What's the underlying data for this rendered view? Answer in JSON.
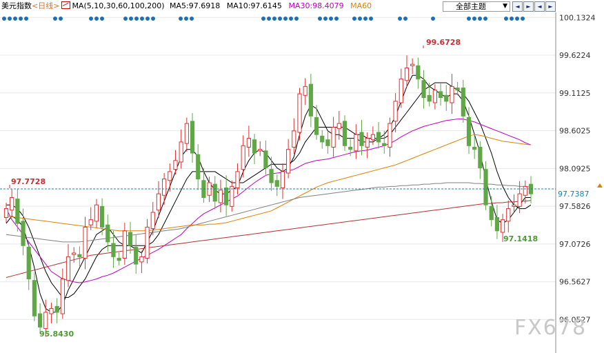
{
  "header": {
    "title": "美元指数",
    "period": "<日线>",
    "ma_label": "MA(5,10,30,60,100,200)",
    "ma5": "MA5:97.6918",
    "ma10": "MA10:97.6145",
    "ma30": "MA30:98.4079",
    "ma60": "MA60",
    "theme_label": "全部主题",
    "colors": {
      "ma5": "#000000",
      "ma10": "#000000",
      "ma30": "#c000c0",
      "ma60": "#e08000",
      "period": "#e07020"
    }
  },
  "nav_buttons": [
    "◄",
    "►",
    "◄",
    "►"
  ],
  "watermark": "FX678",
  "chart_data": {
    "type": "candlestick",
    "ylim": [
      95.6,
      100.2
    ],
    "yticks": [
      "100.1324",
      "99.6224",
      "99.1125",
      "98.6025",
      "98.0925",
      "97.5826",
      "97.0726",
      "96.5627",
      "96.0527"
    ],
    "annotations": {
      "high": "99.6728",
      "low_left": "95.8430",
      "low_right": "97.1418",
      "level_left": "97.7728",
      "current": "97.7387"
    },
    "up_color": "#e03030",
    "down_color": "#60a845",
    "closes": [
      97.55,
      97.7,
      97.35,
      97.05,
      96.6,
      96.1,
      95.95,
      96.15,
      96.2,
      96.15,
      96.6,
      96.9,
      96.95,
      96.9,
      97.3,
      97.4,
      97.6,
      97.3,
      97.1,
      96.9,
      96.85,
      97.25,
      97.05,
      96.8,
      96.9,
      97.3,
      97.5,
      97.75,
      97.95,
      98.05,
      98.2,
      98.45,
      98.7,
      98.3,
      97.95,
      97.7,
      97.9,
      97.65,
      97.8,
      97.6,
      97.85,
      98.05,
      98.4,
      98.5,
      98.3,
      98.35,
      98.1,
      97.9,
      97.85,
      98.05,
      98.35,
      98.6,
      99.1,
      99.2,
      98.8,
      98.55,
      98.45,
      98.4,
      98.65,
      98.7,
      98.4,
      98.35,
      98.55,
      98.4,
      98.5,
      98.55,
      98.45,
      98.4,
      98.7,
      99.0,
      99.3,
      99.45,
      99.5,
      99.3,
      99.05,
      99.0,
      99.15,
      99.05,
      99.0,
      99.2,
      99.15,
      98.8,
      98.4,
      98.35,
      98.1,
      97.6,
      97.4,
      97.25,
      97.4,
      97.55,
      97.6,
      97.75,
      97.85,
      97.75
    ],
    "ma_lines": [
      {
        "name": "MA5",
        "color": "#000000",
        "values": [
          97.35,
          97.45,
          97.4,
          97.3,
          97.05,
          96.75,
          96.4,
          96.2,
          96.15,
          96.15,
          96.25,
          96.45,
          96.6,
          96.75,
          96.9,
          97.05,
          97.2,
          97.25,
          97.3,
          97.2,
          97.1,
          97.05,
          97.05,
          97.0,
          96.95,
          97.1,
          97.25,
          97.45,
          97.65,
          97.85,
          98.05,
          98.25,
          98.35,
          98.35,
          98.25,
          98.05,
          97.9,
          97.8,
          97.75,
          97.75,
          97.8,
          97.85,
          98.05,
          98.2,
          98.3,
          98.35,
          98.3,
          98.2,
          98.1,
          98.05,
          98.1,
          98.25,
          98.55,
          98.8,
          98.95,
          98.9,
          98.75,
          98.6,
          98.55,
          98.55,
          98.5,
          98.5,
          98.5,
          98.45,
          98.45,
          98.45,
          98.5,
          98.55,
          98.65,
          98.8,
          99.0,
          99.2,
          99.35,
          99.35,
          99.3,
          99.2,
          99.15,
          99.1,
          99.05,
          99.1,
          99.1,
          99.0,
          98.8,
          98.55,
          98.3,
          97.95,
          97.65,
          97.4,
          97.35,
          97.4,
          97.5,
          97.6,
          97.7,
          97.7
        ]
      },
      {
        "name": "MA10",
        "color": "#000000",
        "values": [
          97.6,
          97.6,
          97.55,
          97.45,
          97.3,
          97.1,
          96.9,
          96.7,
          96.55,
          96.45,
          96.35,
          96.35,
          96.4,
          96.5,
          96.6,
          96.75,
          96.9,
          97.0,
          97.05,
          97.05,
          97.05,
          97.05,
          97.05,
          97.05,
          97.05,
          97.05,
          97.1,
          97.2,
          97.35,
          97.5,
          97.65,
          97.8,
          97.95,
          98.05,
          98.05,
          98.05,
          98.05,
          98.05,
          98.0,
          97.95,
          97.9,
          97.9,
          97.9,
          97.95,
          98.0,
          98.05,
          98.1,
          98.15,
          98.15,
          98.15,
          98.15,
          98.2,
          98.3,
          98.45,
          98.55,
          98.65,
          98.65,
          98.65,
          98.65,
          98.65,
          98.65,
          98.6,
          98.55,
          98.55,
          98.5,
          98.5,
          98.5,
          98.5,
          98.55,
          98.65,
          98.75,
          98.85,
          98.95,
          99.05,
          99.15,
          99.2,
          99.25,
          99.25,
          99.25,
          99.2,
          99.15,
          99.1,
          99.0,
          98.85,
          98.7,
          98.5,
          98.3,
          98.05,
          97.85,
          97.7,
          97.6,
          97.55,
          97.55,
          97.6
        ]
      },
      {
        "name": "MA30",
        "color": "#c000c0",
        "values": [
          97.55,
          97.4,
          97.3,
          97.2,
          97.1,
          97.0,
          96.9,
          96.8,
          96.7,
          96.65,
          96.6,
          96.58,
          96.56,
          96.55,
          96.56,
          96.58,
          96.6,
          96.63,
          96.65,
          96.68,
          96.72,
          96.76,
          96.8,
          96.84,
          96.88,
          96.92,
          96.96,
          97.0,
          97.05,
          97.1,
          97.15,
          97.2,
          97.28,
          97.35,
          97.42,
          97.48,
          97.52,
          97.56,
          97.6,
          97.64,
          97.68,
          97.72,
          97.78,
          97.84,
          97.9,
          97.95,
          98.0,
          98.02,
          98.03,
          98.04,
          98.06,
          98.08,
          98.12,
          98.16,
          98.18,
          98.2,
          98.21,
          98.22,
          98.24,
          98.26,
          98.28,
          98.3,
          98.32,
          98.33,
          98.34,
          98.36,
          98.38,
          98.4,
          98.43,
          98.47,
          98.52,
          98.56,
          98.6,
          98.63,
          98.66,
          98.68,
          98.7,
          98.72,
          98.74,
          98.75,
          98.76,
          98.76,
          98.74,
          98.72,
          98.69,
          98.66,
          98.63,
          98.6,
          98.57,
          98.54,
          98.51,
          98.48,
          98.44,
          98.41
        ]
      },
      {
        "name": "MA60",
        "color": "#e08000",
        "values": [
          97.45,
          97.44,
          97.43,
          97.42,
          97.41,
          97.4,
          97.39,
          97.38,
          97.37,
          97.36,
          97.35,
          97.34,
          97.33,
          97.32,
          97.31,
          97.3,
          97.29,
          97.28,
          97.27,
          97.26,
          97.25,
          97.25,
          97.25,
          97.25,
          97.25,
          97.25,
          97.26,
          97.27,
          97.28,
          97.29,
          97.3,
          97.31,
          97.32,
          97.33,
          97.33,
          97.33,
          97.34,
          97.34,
          97.35,
          97.36,
          97.38,
          97.4,
          97.42,
          97.44,
          97.46,
          97.48,
          97.5,
          97.52,
          97.56,
          97.6,
          97.64,
          97.68,
          97.72,
          97.76,
          97.8,
          97.84,
          97.87,
          97.9,
          97.92,
          97.94,
          97.96,
          97.98,
          98.0,
          98.02,
          98.04,
          98.06,
          98.08,
          98.1,
          98.12,
          98.14,
          98.17,
          98.2,
          98.23,
          98.26,
          98.29,
          98.32,
          98.35,
          98.38,
          98.41,
          98.44,
          98.47,
          98.5,
          98.53,
          98.55,
          98.54,
          98.52,
          98.5,
          98.48,
          98.46,
          98.45,
          98.44,
          98.43,
          98.42,
          98.41
        ]
      },
      {
        "name": "MA100",
        "color": "#808080",
        "values": [
          97.2,
          97.19,
          97.18,
          97.17,
          97.16,
          97.15,
          97.14,
          97.13,
          97.12,
          97.11,
          97.1,
          97.1,
          97.1,
          97.1,
          97.11,
          97.12,
          97.13,
          97.14,
          97.15,
          97.16,
          97.17,
          97.18,
          97.19,
          97.2,
          97.21,
          97.22,
          97.23,
          97.24,
          97.25,
          97.26,
          97.27,
          97.28,
          97.3,
          97.32,
          97.34,
          97.36,
          97.38,
          97.4,
          97.42,
          97.44,
          97.46,
          97.48,
          97.5,
          97.52,
          97.54,
          97.56,
          97.58,
          97.6,
          97.62,
          97.64,
          97.66,
          97.68,
          97.7,
          97.71,
          97.72,
          97.73,
          97.74,
          97.75,
          97.76,
          97.77,
          97.78,
          97.79,
          97.8,
          97.81,
          97.82,
          97.83,
          97.84,
          97.84,
          97.85,
          97.85,
          97.86,
          97.86,
          97.87,
          97.87,
          97.88,
          97.88,
          97.89,
          97.89,
          97.9,
          97.9,
          97.9,
          97.9,
          97.9,
          97.89,
          97.89,
          97.88,
          97.88,
          97.87,
          97.87,
          97.86,
          97.86,
          97.85,
          97.85,
          97.84
        ]
      },
      {
        "name": "MA200",
        "color": "#b03030",
        "values": [
          96.62,
          96.64,
          96.66,
          96.68,
          96.7,
          96.72,
          96.74,
          96.76,
          96.78,
          96.8,
          96.82,
          96.84,
          96.86,
          96.88,
          96.9,
          96.92,
          96.93,
          96.94,
          96.95,
          96.96,
          96.97,
          96.98,
          96.99,
          97.0,
          97.01,
          97.02,
          97.03,
          97.04,
          97.05,
          97.06,
          97.07,
          97.08,
          97.09,
          97.1,
          97.11,
          97.12,
          97.13,
          97.14,
          97.15,
          97.16,
          97.17,
          97.18,
          97.19,
          97.2,
          97.21,
          97.22,
          97.23,
          97.24,
          97.25,
          97.26,
          97.27,
          97.28,
          97.29,
          97.3,
          97.31,
          97.32,
          97.33,
          97.34,
          97.35,
          97.36,
          97.37,
          97.38,
          97.39,
          97.4,
          97.41,
          97.42,
          97.43,
          97.44,
          97.45,
          97.46,
          97.47,
          97.48,
          97.49,
          97.5,
          97.51,
          97.52,
          97.53,
          97.54,
          97.55,
          97.56,
          97.57,
          97.58,
          97.59,
          97.6,
          97.61,
          97.62,
          97.62,
          97.63,
          97.63,
          97.64,
          97.64,
          97.65,
          97.65,
          97.66
        ]
      }
    ]
  }
}
